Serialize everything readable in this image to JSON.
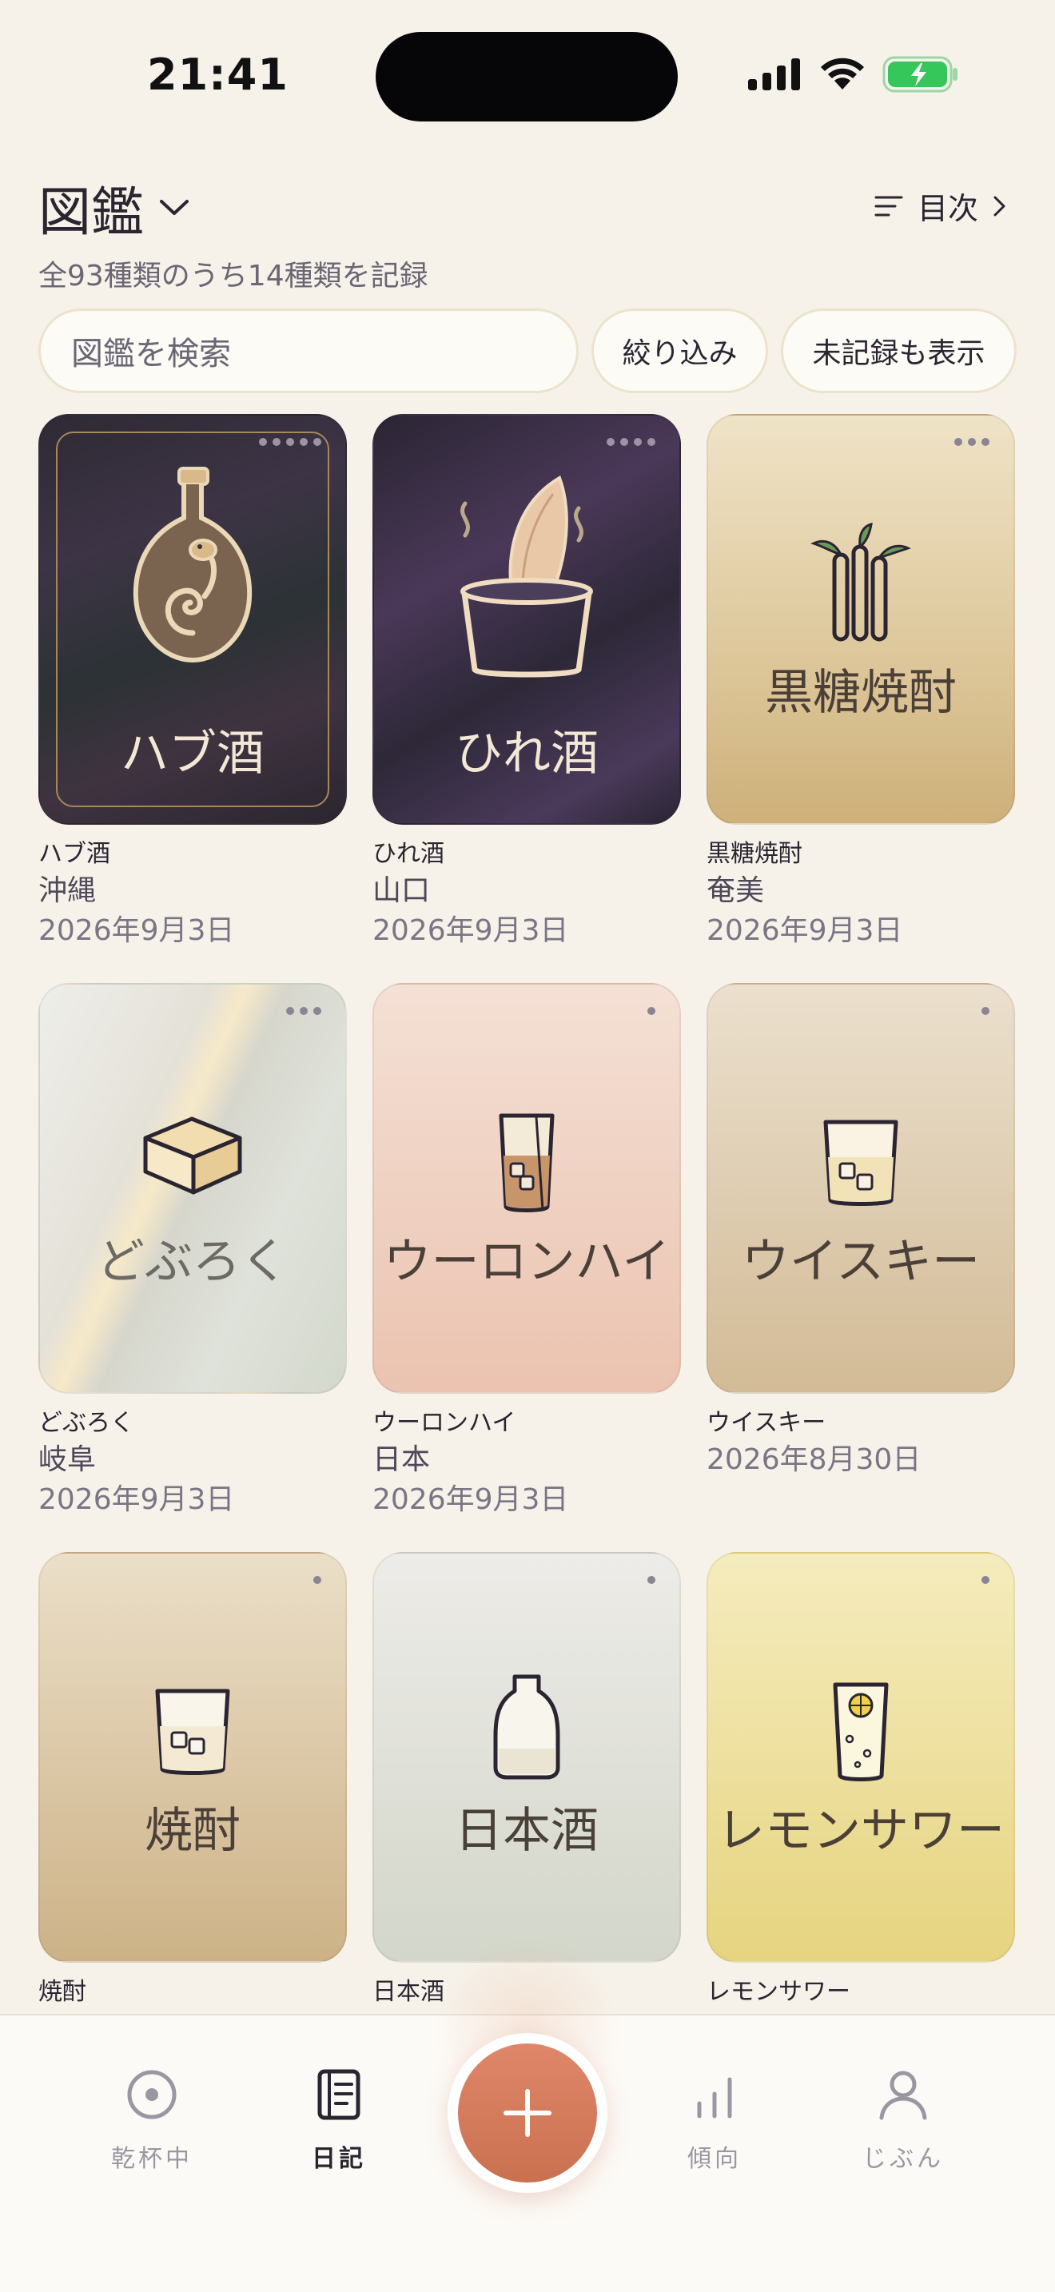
{
  "status": {
    "time": "21:41"
  },
  "header": {
    "title": "図鑑",
    "toc_label": "目次",
    "summary": "全93種類のうち14種類を記録"
  },
  "search": {
    "placeholder": "図鑑を検索",
    "filter_label": "絞り込み",
    "show_unrecorded_label": "未記録も表示"
  },
  "cards": [
    {
      "card_label": "ハブ酒",
      "name": "ハブ酒",
      "region": "沖縄",
      "date": "2026年9月3日"
    },
    {
      "card_label": "ひれ酒",
      "name": "ひれ酒",
      "region": "山口",
      "date": "2026年9月3日"
    },
    {
      "card_label": "黒糖焼酎",
      "name": "黒糖焼酎",
      "region": "奄美",
      "date": "2026年9月3日"
    },
    {
      "card_label": "どぶろく",
      "name": "どぶろく",
      "region": "岐阜",
      "date": "2026年9月3日"
    },
    {
      "card_label": "ウーロンハイ",
      "name": "ウーロンハイ",
      "region": "日本",
      "date": "2026年9月3日"
    },
    {
      "card_label": "ウイスキー",
      "name": "ウイスキー",
      "region": "",
      "date": "2026年8月30日"
    },
    {
      "card_label": "焼酎",
      "name": "焼酎",
      "region": "",
      "date": ""
    },
    {
      "card_label": "日本酒",
      "name": "日本酒",
      "region": "",
      "date": ""
    },
    {
      "card_label": "レモンサワー",
      "name": "レモンサワー",
      "region": "",
      "date": ""
    }
  ],
  "nav": {
    "toast": "乾杯中",
    "diary": "日記",
    "trends": "傾向",
    "me": "じぶん"
  },
  "colors": {
    "accent": "#d27a5c",
    "background": "#f6f2ea"
  }
}
